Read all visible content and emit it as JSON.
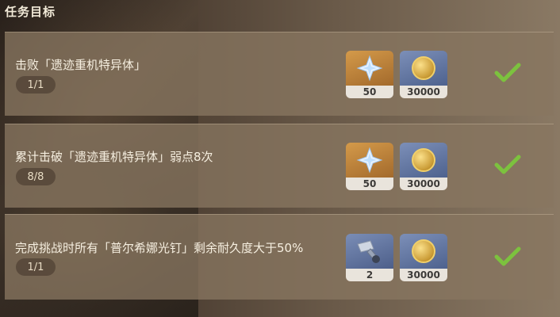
{
  "header": {
    "title": "任务目标"
  },
  "objectives": [
    {
      "text": "击败「遗迹重机特异体」",
      "progress": "1/1",
      "rewards": [
        {
          "icon": "primogem-icon",
          "count": "50"
        },
        {
          "icon": "mora-coin-icon",
          "count": "30000"
        }
      ],
      "completed": true
    },
    {
      "text": "累计击破「遗迹重机特异体」弱点8次",
      "progress": "8/8",
      "rewards": [
        {
          "icon": "primogem-icon",
          "count": "50"
        },
        {
          "icon": "mora-coin-icon",
          "count": "30000"
        }
      ],
      "completed": true
    },
    {
      "text": "完成挑战时所有「普尔希娜光钉」剩余耐久度大于50%",
      "progress": "1/1",
      "rewards": [
        {
          "icon": "gadget-hammer-icon",
          "count": "2"
        },
        {
          "icon": "mora-coin-icon",
          "count": "30000"
        }
      ],
      "completed": true
    }
  ],
  "colors": {
    "check": "#7cc23e",
    "card": "#887660",
    "text": "#f6efe0"
  }
}
